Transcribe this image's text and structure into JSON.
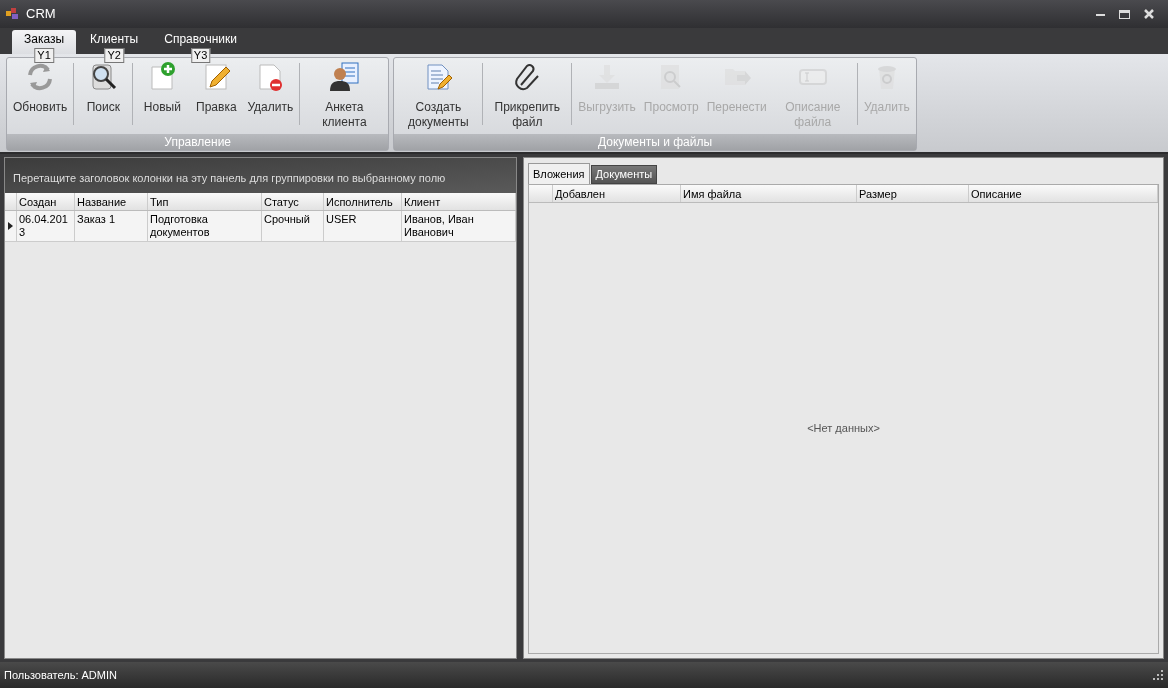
{
  "window": {
    "title": "CRM"
  },
  "ribbon_tabs": [
    {
      "label": "Заказы",
      "selected": true,
      "keytip": "Y1"
    },
    {
      "label": "Клиенты",
      "selected": false,
      "keytip": "Y2"
    },
    {
      "label": "Справочники",
      "selected": false,
      "keytip": "Y3"
    }
  ],
  "ribbon_groups": [
    {
      "title": "Управление",
      "buttons": [
        {
          "label": "Обновить",
          "disabled": false
        },
        {
          "label": "Поиск",
          "disabled": false
        },
        {
          "label": "Новый",
          "disabled": false
        },
        {
          "label": "Правка",
          "disabled": false
        },
        {
          "label": "Удалить",
          "disabled": false
        },
        {
          "label": "Анкета клиента",
          "disabled": false
        }
      ]
    },
    {
      "title": "Документы и файлы",
      "buttons": [
        {
          "label": "Создать документы",
          "disabled": false
        },
        {
          "label": "Прикрепить файл",
          "disabled": false
        },
        {
          "label": "Выгрузить",
          "disabled": true
        },
        {
          "label": "Просмотр",
          "disabled": true
        },
        {
          "label": "Перенести",
          "disabled": true
        },
        {
          "label": "Описание файла",
          "disabled": true
        },
        {
          "label": "Удалить",
          "disabled": true
        }
      ]
    }
  ],
  "orders_grid": {
    "group_panel_hint": "Перетащите заголовок колонки на эту панель для группировки по выбранному полю",
    "columns": [
      "Создан",
      "Название",
      "Тип",
      "Статус",
      "Исполнитель",
      "Клиент"
    ],
    "rows": [
      {
        "selected": true,
        "cells": [
          "06.04.2013",
          "Заказ 1",
          "Подготовка документов",
          "Срочный",
          "USER",
          "Иванов, Иван Иванович"
        ]
      }
    ]
  },
  "files_panel": {
    "tabs": [
      {
        "label": "Вложения",
        "selected": true
      },
      {
        "label": "Документы",
        "selected": false
      }
    ],
    "columns": [
      "Добавлен",
      "Имя файла",
      "Размер",
      "Описание"
    ],
    "empty_text": "<Нет данных>"
  },
  "status_bar": {
    "text": "Пользователь: ADMIN"
  }
}
